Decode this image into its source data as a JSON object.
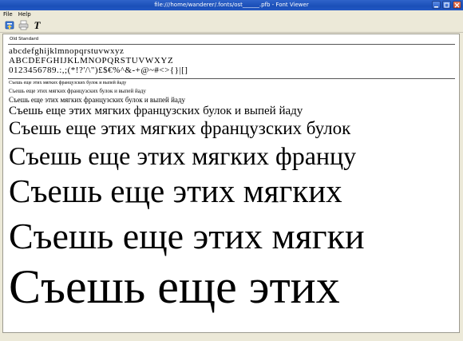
{
  "window": {
    "title": "file:///home/wanderer/.fonts/ost______.pfb - Font Viewer"
  },
  "menu": {
    "file": "File",
    "help": "Help"
  },
  "toolbar": {
    "icons": [
      "install-icon",
      "print-icon",
      "text-icon"
    ],
    "text_tool_glyph": "T"
  },
  "preview": {
    "font_name": "Old Standard",
    "lowercase": "abcdefghijklmnopqrstuvwxyz",
    "uppercase": "ABCDEFGHIJKLMNOPQRSTUVWXYZ",
    "digits_symbols": "0123456789.:,;(*!?'/\\\")£$€%^&-+@~#<>{}|[]",
    "sample_text": "Съешь еще этих мягких французских булок и выпей йаду",
    "samples": [
      "Съешь еще этих мягких французских булок и выпей йаду",
      "Съешь еще этих мягких французских булок и выпей йаду",
      "Съешь еще этих мягких французских булок и выпей йаду",
      "Съешь еще этих мягких французских булок и выпей йаду",
      "Съешь еще этих мягких французских булок",
      "Съешь еще этих мягких францу",
      "Съешь еще этих мягких",
      "Съешь еще этих мягки",
      "Съешь еще этих"
    ]
  },
  "colors": {
    "titlebar": "#2458c3",
    "chrome": "#ece9d8",
    "canvas": "#ffffff"
  }
}
